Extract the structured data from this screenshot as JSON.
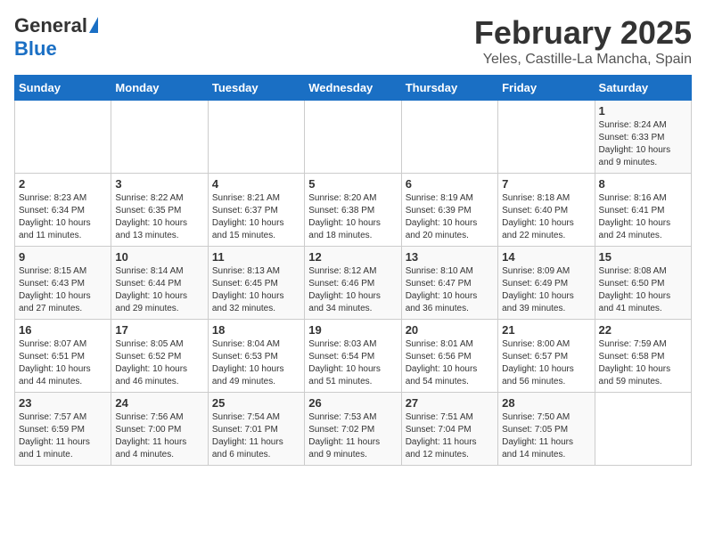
{
  "logo": {
    "general": "General",
    "blue": "Blue"
  },
  "title": "February 2025",
  "subtitle": "Yeles, Castille-La Mancha, Spain",
  "days_of_week": [
    "Sunday",
    "Monday",
    "Tuesday",
    "Wednesday",
    "Thursday",
    "Friday",
    "Saturday"
  ],
  "weeks": [
    [
      {
        "day": "",
        "info": ""
      },
      {
        "day": "",
        "info": ""
      },
      {
        "day": "",
        "info": ""
      },
      {
        "day": "",
        "info": ""
      },
      {
        "day": "",
        "info": ""
      },
      {
        "day": "",
        "info": ""
      },
      {
        "day": "1",
        "info": "Sunrise: 8:24 AM\nSunset: 6:33 PM\nDaylight: 10 hours\nand 9 minutes."
      }
    ],
    [
      {
        "day": "2",
        "info": "Sunrise: 8:23 AM\nSunset: 6:34 PM\nDaylight: 10 hours\nand 11 minutes."
      },
      {
        "day": "3",
        "info": "Sunrise: 8:22 AM\nSunset: 6:35 PM\nDaylight: 10 hours\nand 13 minutes."
      },
      {
        "day": "4",
        "info": "Sunrise: 8:21 AM\nSunset: 6:37 PM\nDaylight: 10 hours\nand 15 minutes."
      },
      {
        "day": "5",
        "info": "Sunrise: 8:20 AM\nSunset: 6:38 PM\nDaylight: 10 hours\nand 18 minutes."
      },
      {
        "day": "6",
        "info": "Sunrise: 8:19 AM\nSunset: 6:39 PM\nDaylight: 10 hours\nand 20 minutes."
      },
      {
        "day": "7",
        "info": "Sunrise: 8:18 AM\nSunset: 6:40 PM\nDaylight: 10 hours\nand 22 minutes."
      },
      {
        "day": "8",
        "info": "Sunrise: 8:16 AM\nSunset: 6:41 PM\nDaylight: 10 hours\nand 24 minutes."
      }
    ],
    [
      {
        "day": "9",
        "info": "Sunrise: 8:15 AM\nSunset: 6:43 PM\nDaylight: 10 hours\nand 27 minutes."
      },
      {
        "day": "10",
        "info": "Sunrise: 8:14 AM\nSunset: 6:44 PM\nDaylight: 10 hours\nand 29 minutes."
      },
      {
        "day": "11",
        "info": "Sunrise: 8:13 AM\nSunset: 6:45 PM\nDaylight: 10 hours\nand 32 minutes."
      },
      {
        "day": "12",
        "info": "Sunrise: 8:12 AM\nSunset: 6:46 PM\nDaylight: 10 hours\nand 34 minutes."
      },
      {
        "day": "13",
        "info": "Sunrise: 8:10 AM\nSunset: 6:47 PM\nDaylight: 10 hours\nand 36 minutes."
      },
      {
        "day": "14",
        "info": "Sunrise: 8:09 AM\nSunset: 6:49 PM\nDaylight: 10 hours\nand 39 minutes."
      },
      {
        "day": "15",
        "info": "Sunrise: 8:08 AM\nSunset: 6:50 PM\nDaylight: 10 hours\nand 41 minutes."
      }
    ],
    [
      {
        "day": "16",
        "info": "Sunrise: 8:07 AM\nSunset: 6:51 PM\nDaylight: 10 hours\nand 44 minutes."
      },
      {
        "day": "17",
        "info": "Sunrise: 8:05 AM\nSunset: 6:52 PM\nDaylight: 10 hours\nand 46 minutes."
      },
      {
        "day": "18",
        "info": "Sunrise: 8:04 AM\nSunset: 6:53 PM\nDaylight: 10 hours\nand 49 minutes."
      },
      {
        "day": "19",
        "info": "Sunrise: 8:03 AM\nSunset: 6:54 PM\nDaylight: 10 hours\nand 51 minutes."
      },
      {
        "day": "20",
        "info": "Sunrise: 8:01 AM\nSunset: 6:56 PM\nDaylight: 10 hours\nand 54 minutes."
      },
      {
        "day": "21",
        "info": "Sunrise: 8:00 AM\nSunset: 6:57 PM\nDaylight: 10 hours\nand 56 minutes."
      },
      {
        "day": "22",
        "info": "Sunrise: 7:59 AM\nSunset: 6:58 PM\nDaylight: 10 hours\nand 59 minutes."
      }
    ],
    [
      {
        "day": "23",
        "info": "Sunrise: 7:57 AM\nSunset: 6:59 PM\nDaylight: 11 hours\nand 1 minute."
      },
      {
        "day": "24",
        "info": "Sunrise: 7:56 AM\nSunset: 7:00 PM\nDaylight: 11 hours\nand 4 minutes."
      },
      {
        "day": "25",
        "info": "Sunrise: 7:54 AM\nSunset: 7:01 PM\nDaylight: 11 hours\nand 6 minutes."
      },
      {
        "day": "26",
        "info": "Sunrise: 7:53 AM\nSunset: 7:02 PM\nDaylight: 11 hours\nand 9 minutes."
      },
      {
        "day": "27",
        "info": "Sunrise: 7:51 AM\nSunset: 7:04 PM\nDaylight: 11 hours\nand 12 minutes."
      },
      {
        "day": "28",
        "info": "Sunrise: 7:50 AM\nSunset: 7:05 PM\nDaylight: 11 hours\nand 14 minutes."
      },
      {
        "day": "",
        "info": ""
      }
    ]
  ]
}
